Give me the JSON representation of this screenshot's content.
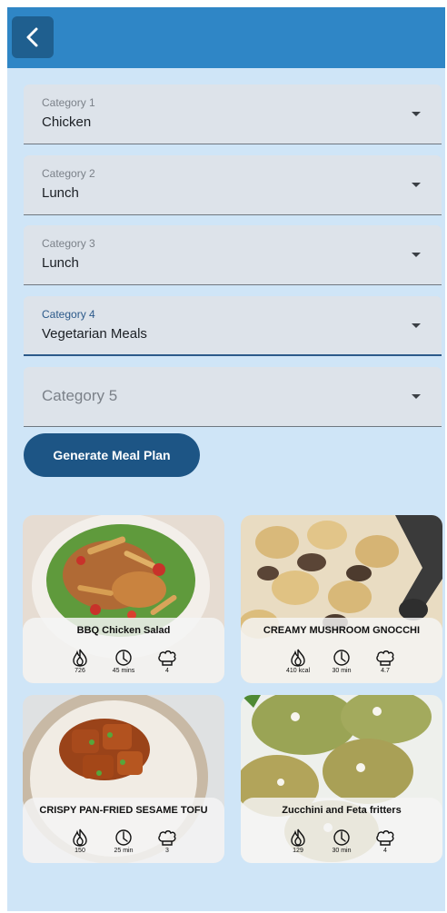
{
  "header": {
    "back_icon": "chevron-left-icon"
  },
  "fields": [
    {
      "label": "Category 1",
      "value": "Chicken"
    },
    {
      "label": "Category 2",
      "value": "Lunch"
    },
    {
      "label": "Category 3",
      "value": "Lunch"
    },
    {
      "label": "Category 4",
      "value": "Vegetarian Meals"
    },
    {
      "placeholder": "Category 5"
    }
  ],
  "generate_label": "Generate Meal Plan",
  "meals": [
    {
      "title": "BBQ Chicken Salad",
      "calories": "726",
      "time": "45 mins",
      "serves": "4"
    },
    {
      "title": "CREAMY MUSHROOM GNOCCHI",
      "calories": "410 kcal",
      "time": "30 min",
      "serves": "4.7"
    },
    {
      "title": "CRISPY PAN-FRIED SESAME TOFU",
      "calories": "150",
      "time": "25 min",
      "serves": "3"
    },
    {
      "title": "Zucchini and Feta fritters",
      "calories": "129",
      "time": "30 min",
      "serves": "4"
    }
  ],
  "icons": {
    "calories": "flame-icon",
    "time": "timer-icon",
    "serves": "chef-hat-icon"
  },
  "colors": {
    "app_bar": "#2f86c6",
    "background": "#cfe5f7",
    "button": "#1d5585",
    "field": "#dde3ea",
    "focus": "#2c5a8a"
  }
}
